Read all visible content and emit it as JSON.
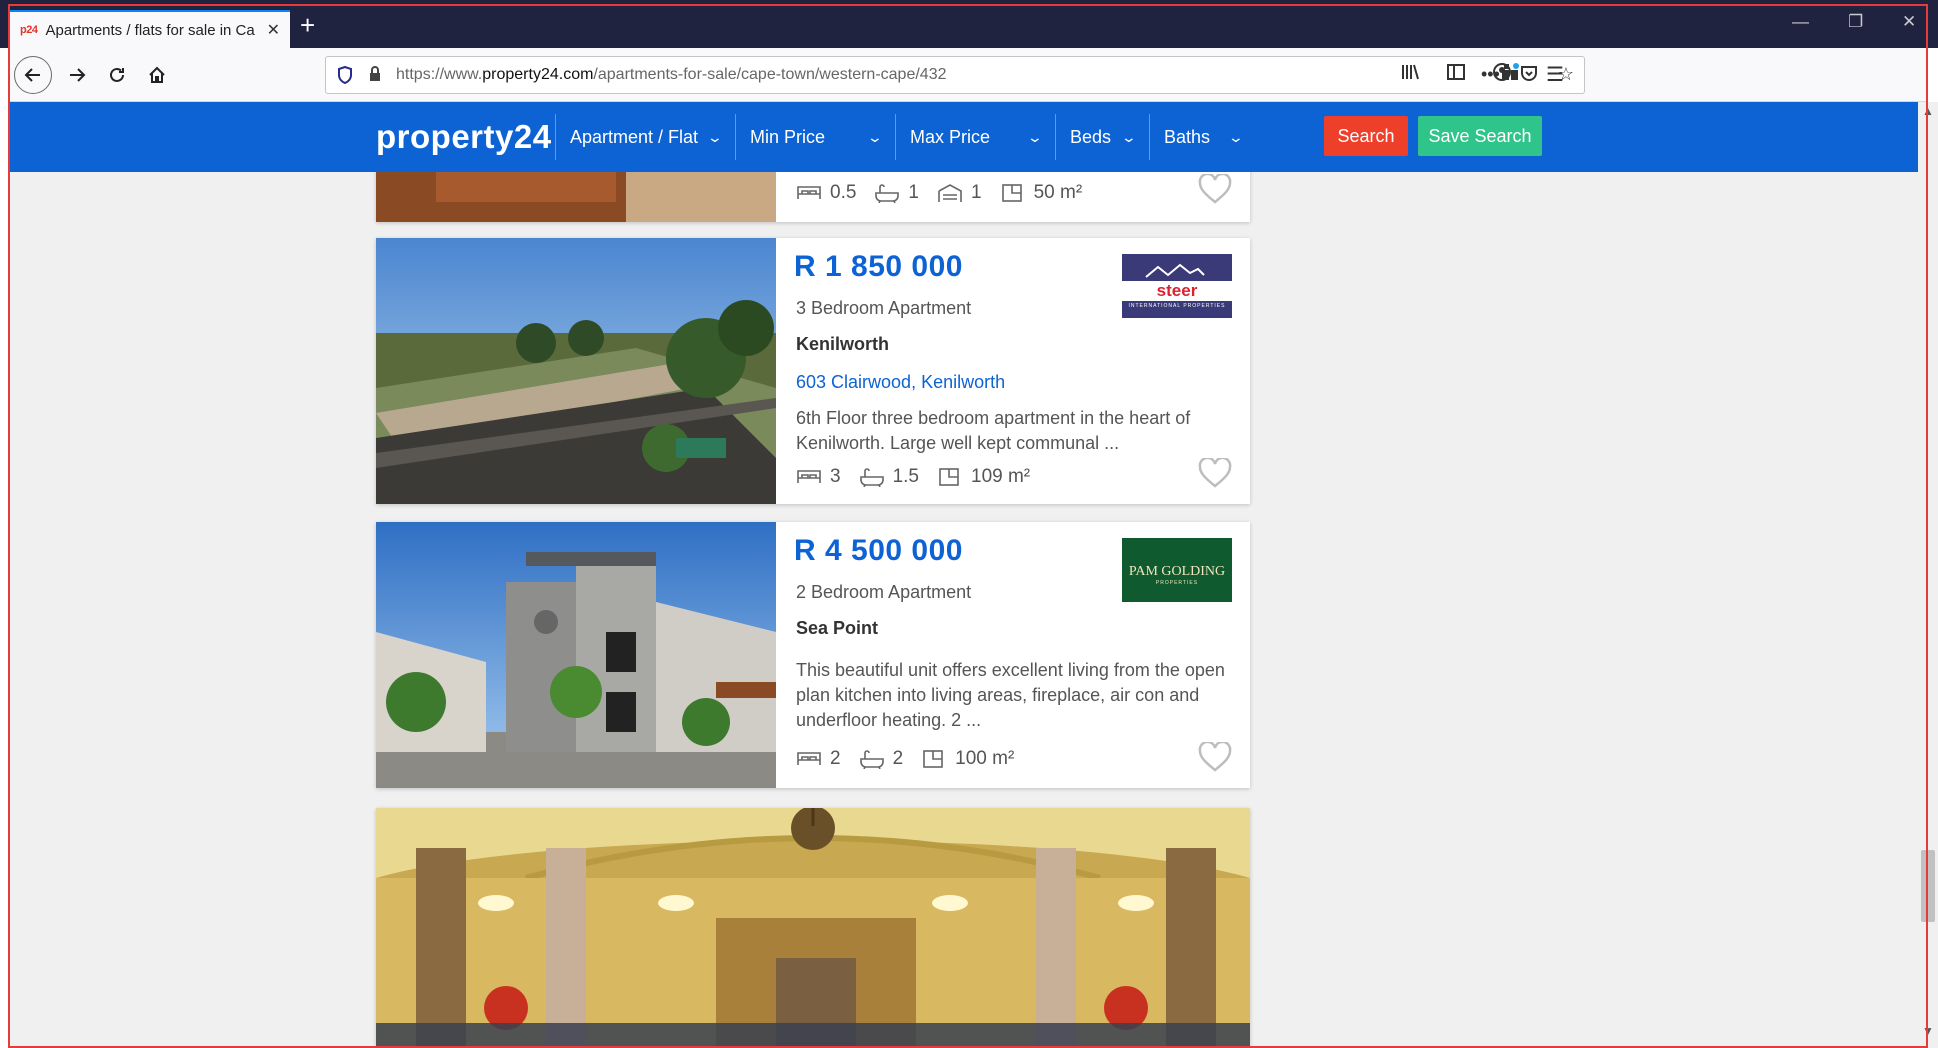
{
  "browser": {
    "tab_title": "Apartments / flats for sale in Cape Town",
    "tab_favicon": "p24",
    "url_prefix": "https://www.",
    "url_domain": "property24.com",
    "url_path": "/apartments-for-sale/cape-town/western-cape/432",
    "icons": [
      "back-arrow-icon",
      "forward-arrow-icon",
      "reload-icon",
      "home-icon",
      "shield-icon",
      "lock-icon",
      "more-icon",
      "pocket-icon",
      "star-icon",
      "library-icon",
      "sidebar-icon",
      "account-icon",
      "extensions-icon",
      "menu-icon"
    ]
  },
  "header": {
    "logo": "property24",
    "filters": [
      {
        "label": "Apartment / Flat"
      },
      {
        "label": "Min Price"
      },
      {
        "label": "Max Price"
      },
      {
        "label": "Beds"
      },
      {
        "label": "Baths"
      }
    ],
    "search_label": "Search",
    "save_search_label": "Save Search",
    "colors": {
      "brand": "#0d63d4",
      "search": "#ee3f2a",
      "save": "#2ec48a"
    }
  },
  "listings": [
    {
      "beds": "0.5",
      "baths": "1",
      "parking": "1",
      "size": "50 m²"
    },
    {
      "price": "R 1 850 000",
      "type": "3 Bedroom Apartment",
      "suburb": "Kenilworth",
      "address": "603 Clairwood, Kenilworth",
      "description": "6th Floor three bedroom apartment in the heart of Kenilworth. Large well kept communal ...",
      "beds": "3",
      "baths": "1.5",
      "size": "109 m²",
      "agent": {
        "name": "steer",
        "sub": "INTERNATIONAL PROPERTIES"
      }
    },
    {
      "price": "R 4 500 000",
      "type": "2 Bedroom Apartment",
      "suburb": "Sea Point",
      "description": "This beautiful unit offers excellent living from the open plan kitchen into living areas, fireplace, air con and underfloor heating. 2 ...",
      "beds": "2",
      "baths": "2",
      "size": "100 m²",
      "agent": {
        "name": "PAM GOLDING",
        "sub": "PROPERTIES"
      }
    }
  ]
}
